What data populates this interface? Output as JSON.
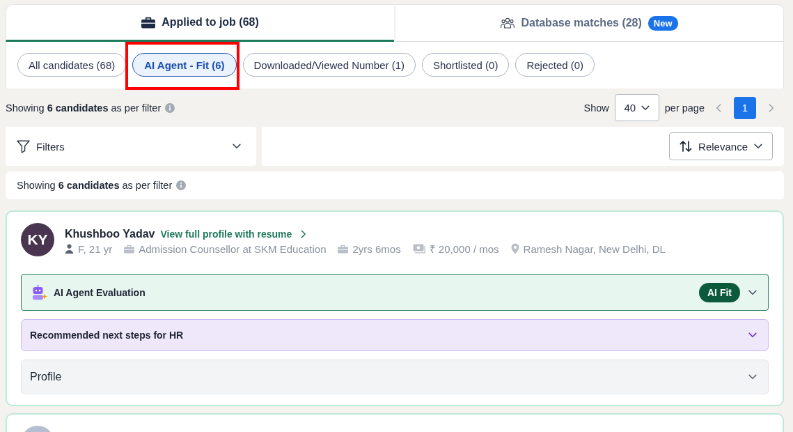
{
  "tabs": [
    {
      "label": "Applied to job (68)",
      "selected": true
    },
    {
      "label": "Database matches (28)",
      "badge": "New",
      "selected": false
    }
  ],
  "filter_chips": [
    {
      "label": "All candidates (68)",
      "selected": false,
      "highlighted": false
    },
    {
      "label": "AI Agent - Fit (6)",
      "selected": true,
      "highlighted": true
    },
    {
      "label": "Downloaded/Viewed Number (1)",
      "selected": false,
      "highlighted": false
    },
    {
      "label": "Shortlisted (0)",
      "selected": false,
      "highlighted": false
    },
    {
      "label": "Rejected (0)",
      "selected": false,
      "highlighted": false
    }
  ],
  "summary": {
    "text": "Showing **6 candidates** as per filter",
    "show_label": "Show",
    "page_size": "40",
    "per_page_label": "per page",
    "pages": [
      {
        "label": "1",
        "selected": true
      }
    ]
  },
  "filters": {
    "label": "Filters",
    "expanded": false
  },
  "sort": {
    "label": "Relevance"
  },
  "result_bar": {
    "text": "Showing **6 candidates** as per filter"
  },
  "candidates": [
    {
      "avatar": {
        "kind": "initials",
        "text": "KY"
      },
      "name": "Khushboo Yadav",
      "profile_link": "View full profile with resume",
      "details": [
        {
          "kind": "person",
          "text": "F, 21 yr"
        },
        {
          "kind": "job",
          "text": "Admission Counsellor at SKM Education"
        },
        {
          "kind": "experience",
          "text": "2yrs 6mos"
        },
        {
          "kind": "salary",
          "text": "₹ 20,000 / mos"
        },
        {
          "kind": "location",
          "text": "Ramesh Nagar, New Delhi, DL"
        }
      ],
      "sections": [
        {
          "kind": "evaluation",
          "title": "AI Agent Evaluation",
          "badge": "AI Fit",
          "expanded": false
        },
        {
          "kind": "next_steps",
          "title": "Recommended next steps for HR",
          "expanded": false
        },
        {
          "kind": "profile",
          "title": "Profile",
          "expanded": false
        }
      ]
    },
    {
      "avatar": {
        "kind": "photo"
      }
    }
  ]
}
